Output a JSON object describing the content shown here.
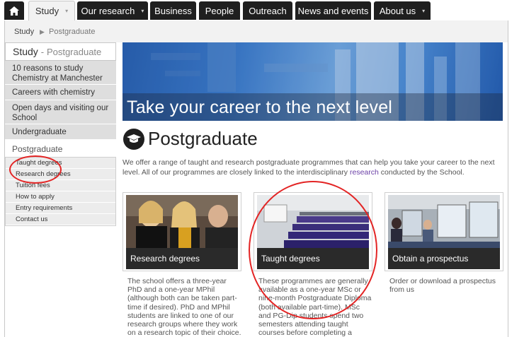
{
  "nav": {
    "tabs": [
      {
        "label": "Study",
        "has_caret": true,
        "active": true
      },
      {
        "label": "Our research",
        "has_caret": true,
        "active": false
      },
      {
        "label": "Business",
        "has_caret": false,
        "active": false
      },
      {
        "label": "People",
        "has_caret": false,
        "active": false
      },
      {
        "label": "Outreach",
        "has_caret": false,
        "active": false
      },
      {
        "label": "News and events",
        "has_caret": false,
        "active": false
      },
      {
        "label": "About us",
        "has_caret": true,
        "active": false
      }
    ],
    "home_icon": "home-icon",
    "caret_glyph": "▾"
  },
  "breadcrumb": {
    "items": [
      "Study",
      "Postgraduate"
    ],
    "separator": "▶"
  },
  "sidebar": {
    "title": "Study",
    "title_sep": "-",
    "title_sub": "Postgraduate",
    "items": [
      "10 reasons to study Chemistry at Manchester",
      "Careers with chemistry",
      "Open days and visiting our School",
      "Undergraduate"
    ],
    "open_item": "Postgraduate",
    "sub_items": [
      "Taught degrees",
      "Research degrees",
      "Tuition fees",
      "How to apply",
      "Entry requirements",
      "Contact us"
    ]
  },
  "hero": {
    "caption": "Take your career to the next level"
  },
  "main": {
    "title": "Postgraduate",
    "title_icon": "graduation-cap-icon",
    "intro_before": "We offer a range of taught and research postgraduate programmes that can help you take your career to the next level. All of our programmes are closely linked to the interdisciplinary ",
    "intro_link": "research",
    "intro_after": " conducted by the School."
  },
  "cards": [
    {
      "label": "Research degrees",
      "text": "The school offers a three-year PhD and a one-year MPhil (although both can be taken part-time if desired). PhD and MPhil students are linked to one of our research groups where they work on a research topic of their choice."
    },
    {
      "label": "Taught degrees",
      "text": "These programmes are generally available as a one-year MSc or nine-month Postgraduate Diploma (both available part-time). MSc and PG-Dip students spend two semesters attending taught courses before completing a project."
    },
    {
      "label": "Obtain a prospectus",
      "text": "Order or download a prospectus from us"
    }
  ],
  "colors": {
    "nav_bg": "#1f1f1f",
    "annotation_red": "#e32424",
    "link_purple": "#6a3fa6"
  }
}
